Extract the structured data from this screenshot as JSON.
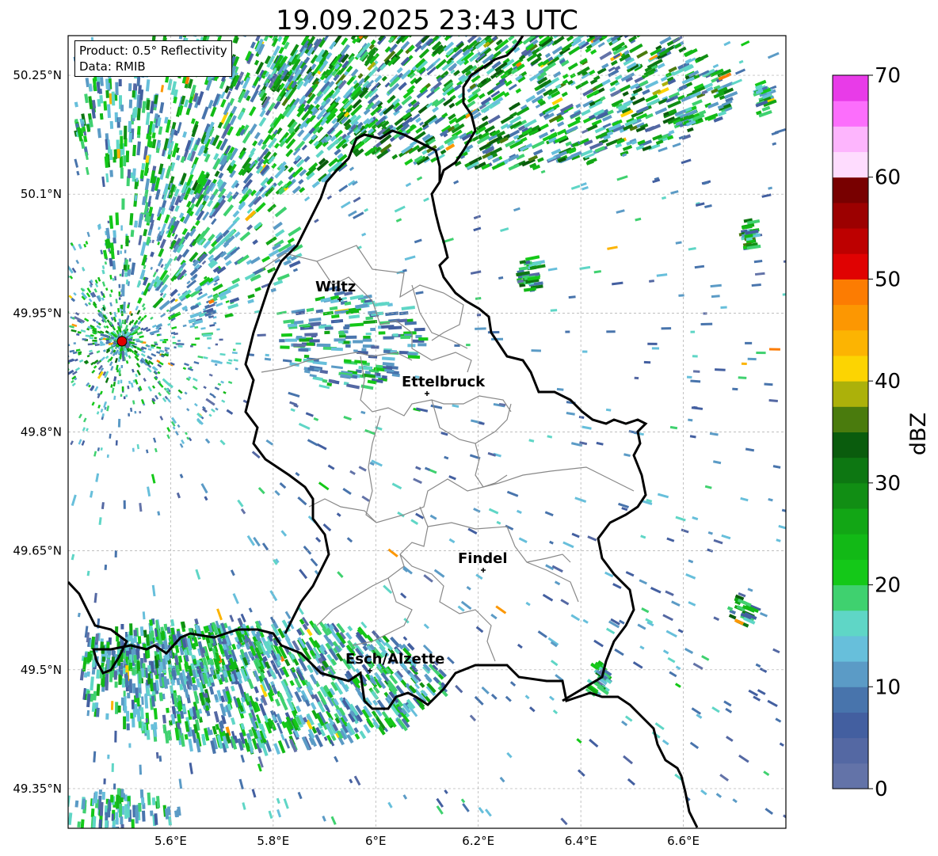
{
  "title": "19.09.2025 23:43 UTC",
  "info": {
    "product": "Product: 0.5° Reflectivity",
    "data": "Data: RMIB"
  },
  "colorbar": {
    "label": "dBZ",
    "ticks": [
      "0",
      "10",
      "20",
      "30",
      "40",
      "50",
      "60",
      "70"
    ],
    "colors": [
      "#6373a8",
      "#5468a3",
      "#435fa0",
      "#4874ac",
      "#5b9bc6",
      "#67bfdb",
      "#5fd6c6",
      "#3fd16f",
      "#14c818",
      "#12b916",
      "#12a615",
      "#118e14",
      "#0d7712",
      "#0a5c0d",
      "#4a7b0d",
      "#acb10a",
      "#fcd402",
      "#fcb402",
      "#fc9702",
      "#fc7c02",
      "#e00202",
      "#bd0000",
      "#9c0000",
      "#780000",
      "#fedcfe",
      "#fdb5fd",
      "#fc6efc",
      "#e83be8"
    ]
  },
  "map": {
    "lat_ticks": [
      "50.25°N",
      "50.1°N",
      "49.95°N",
      "49.8°N",
      "49.65°N",
      "49.5°N",
      "49.35°N"
    ],
    "lon_ticks": [
      "5.6°E",
      "5.8°E",
      "6°E",
      "6.2°E",
      "6.4°E",
      "6.6°E"
    ],
    "cities": [
      {
        "name": "Wiltz"
      },
      {
        "name": "Ettelbruck"
      },
      {
        "name": "Findel"
      },
      {
        "name": "Esch/Alzette"
      }
    ],
    "radar_color": "#e00000",
    "border_color": "#000000",
    "canton_color": "#888888"
  }
}
